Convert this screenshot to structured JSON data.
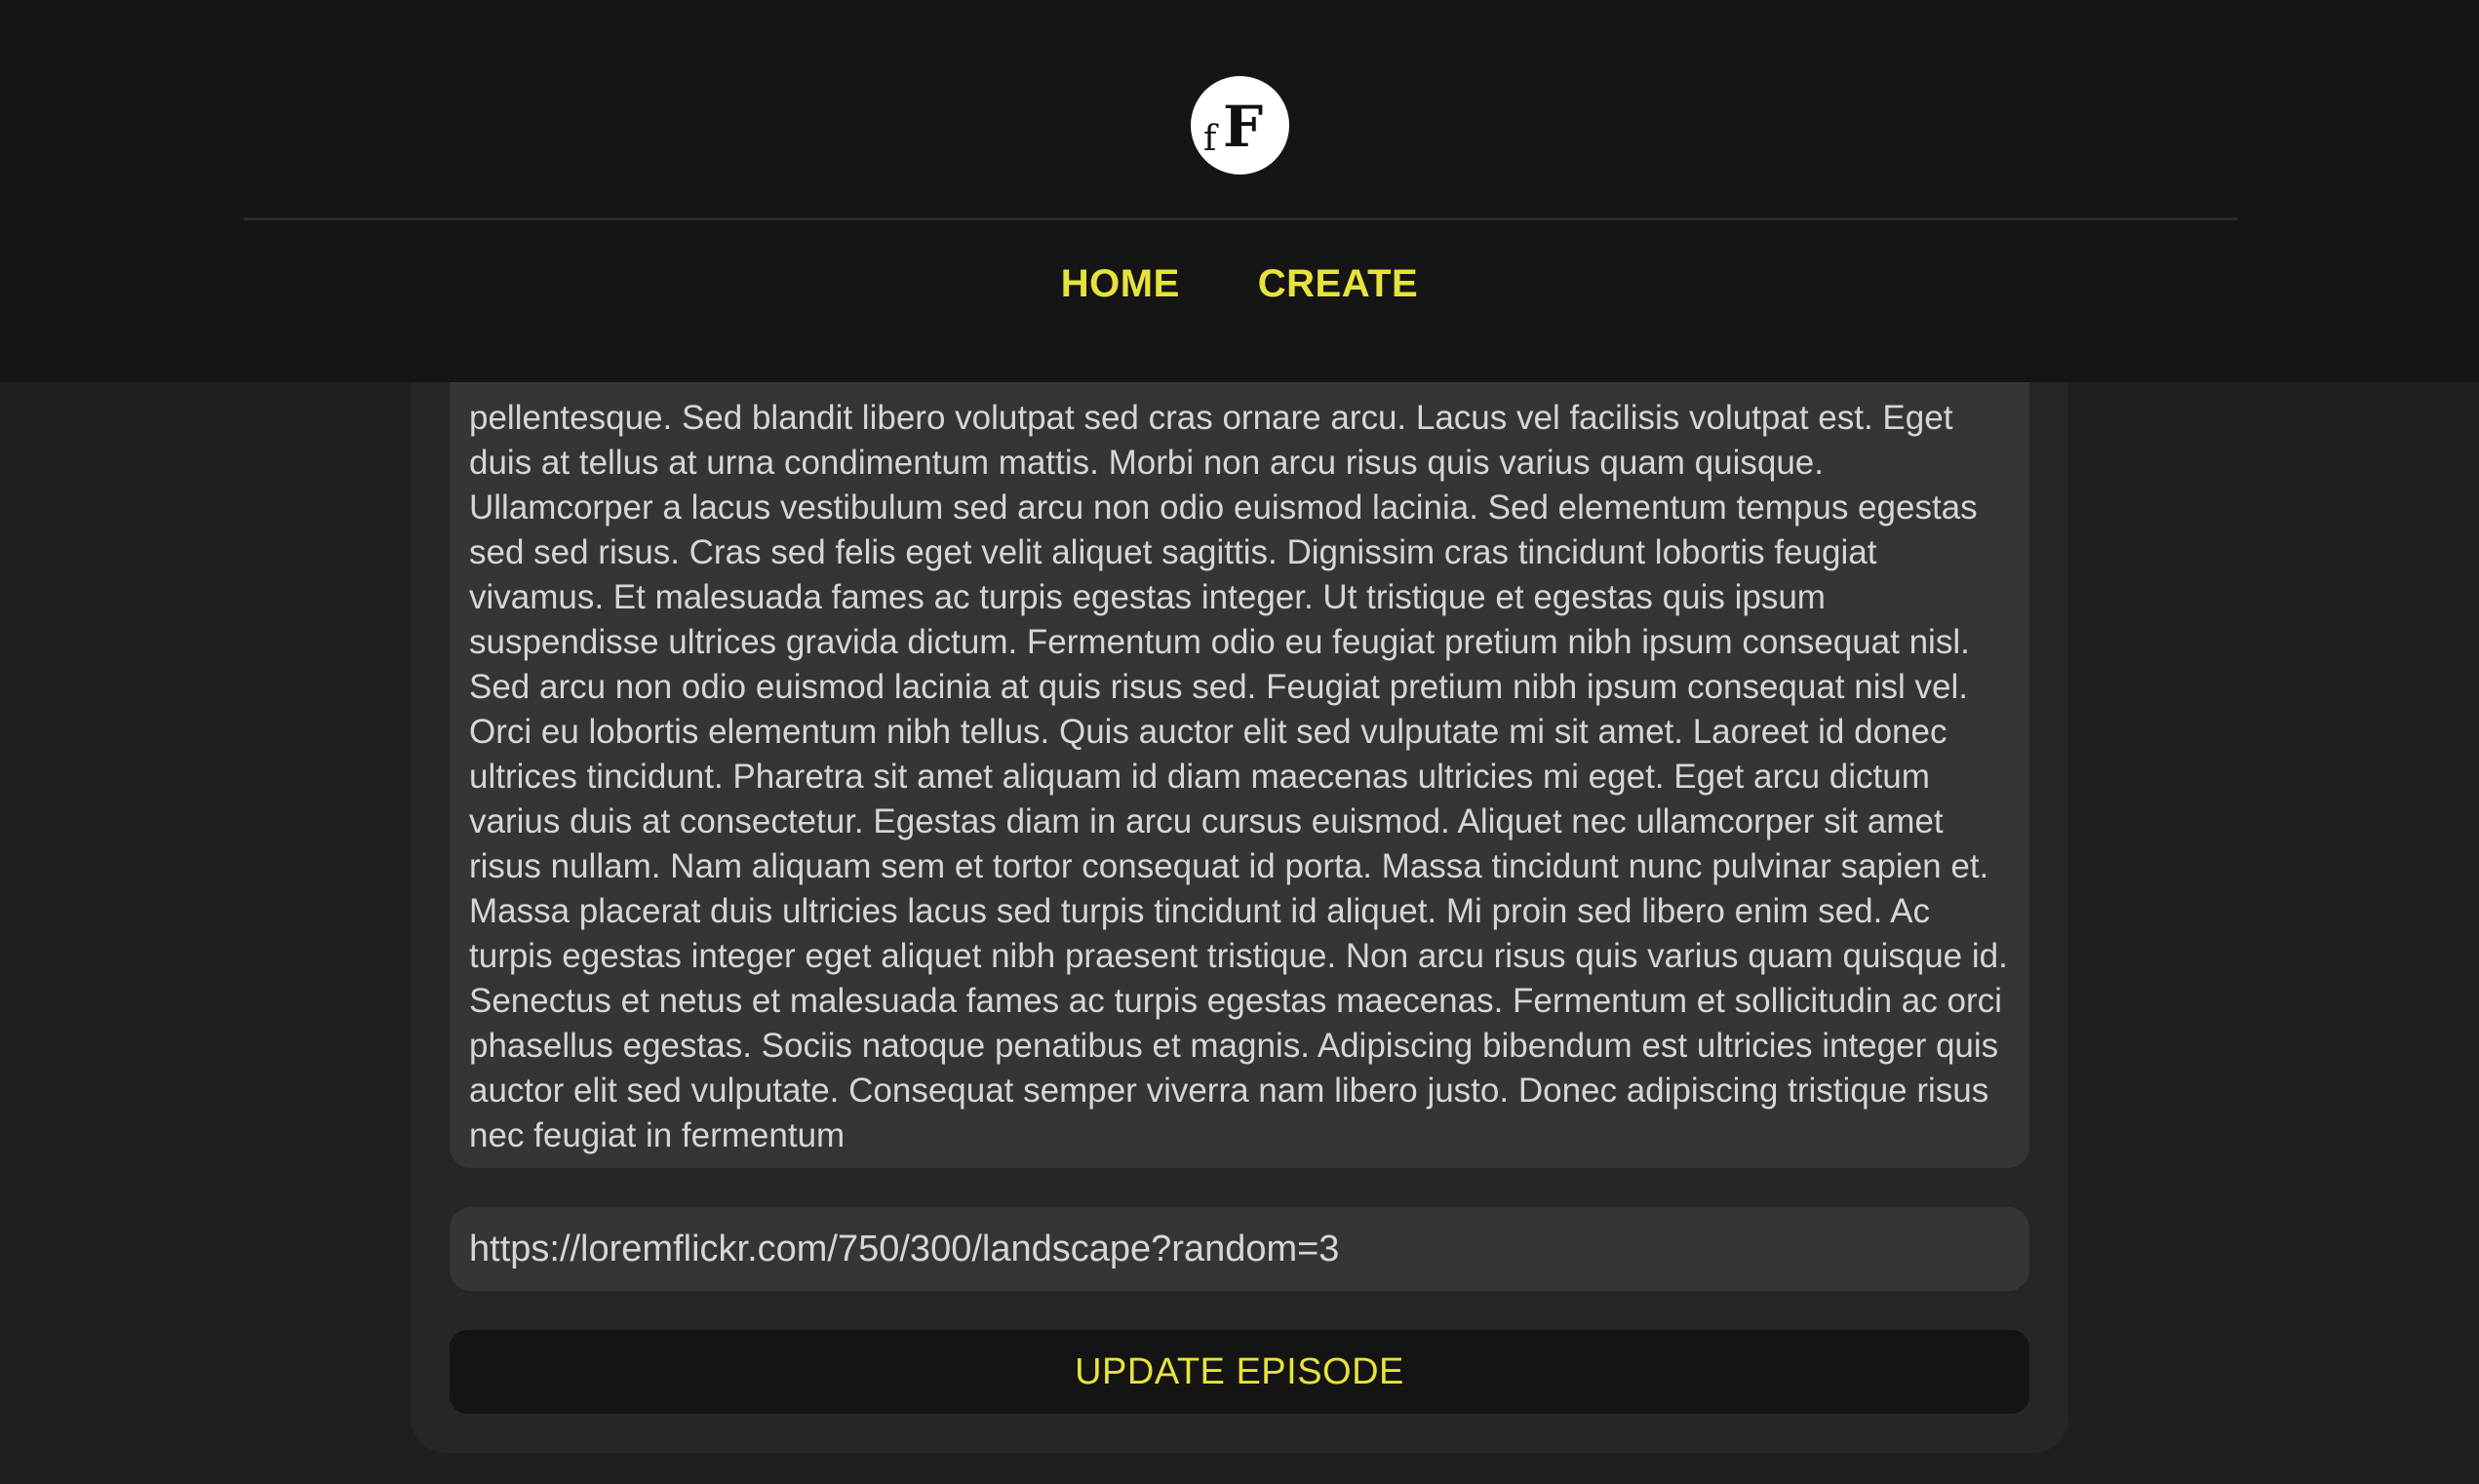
{
  "header": {
    "logo_text": "fF",
    "nav": [
      {
        "label": "HOME"
      },
      {
        "label": "CREATE"
      }
    ],
    "accent_color": "#e7e33b"
  },
  "form": {
    "description_value": "pellentesque. Sed blandit libero volutpat sed cras ornare arcu. Lacus vel facilisis volutpat est. Eget duis at tellus at urna condimentum mattis. Morbi non arcu risus quis varius quam quisque. Ullamcorper a lacus vestibulum sed arcu non odio euismod lacinia. Sed elementum tempus egestas sed sed risus. Cras sed felis eget velit aliquet sagittis. Dignissim cras tincidunt lobortis feugiat vivamus. Et malesuada fames ac turpis egestas integer. Ut tristique et egestas quis ipsum suspendisse ultrices gravida dictum. Fermentum odio eu feugiat pretium nibh ipsum consequat nisl. Sed arcu non odio euismod lacinia at quis risus sed. Feugiat pretium nibh ipsum consequat nisl vel. Orci eu lobortis elementum nibh tellus. Quis auctor elit sed vulputate mi sit amet. Laoreet id donec ultrices tincidunt. Pharetra sit amet aliquam id diam maecenas ultricies mi eget. Eget arcu dictum varius duis at consectetur. Egestas diam in arcu cursus euismod. Aliquet nec ullamcorper sit amet risus nullam. Nam aliquam sem et tortor consequat id porta. Massa tincidunt nunc pulvinar sapien et. Massa placerat duis ultricies lacus sed turpis tincidunt id aliquet. Mi proin sed libero enim sed. Ac turpis egestas integer eget aliquet nibh praesent tristique. Non arcu risus quis varius quam quisque id. Senectus et netus et malesuada fames ac turpis egestas maecenas. Fermentum et sollicitudin ac orci phasellus egestas. Sociis natoque penatibus et magnis. Adipiscing bibendum est ultricies integer quis auctor elit sed vulputate. Consequat semper viverra nam libero justo. Donec adipiscing tristique risus nec feugiat in fermentum",
    "image_url_value": "https://loremflickr.com/750/300/landscape?random=3",
    "submit_label": "UPDATE EPISODE"
  }
}
